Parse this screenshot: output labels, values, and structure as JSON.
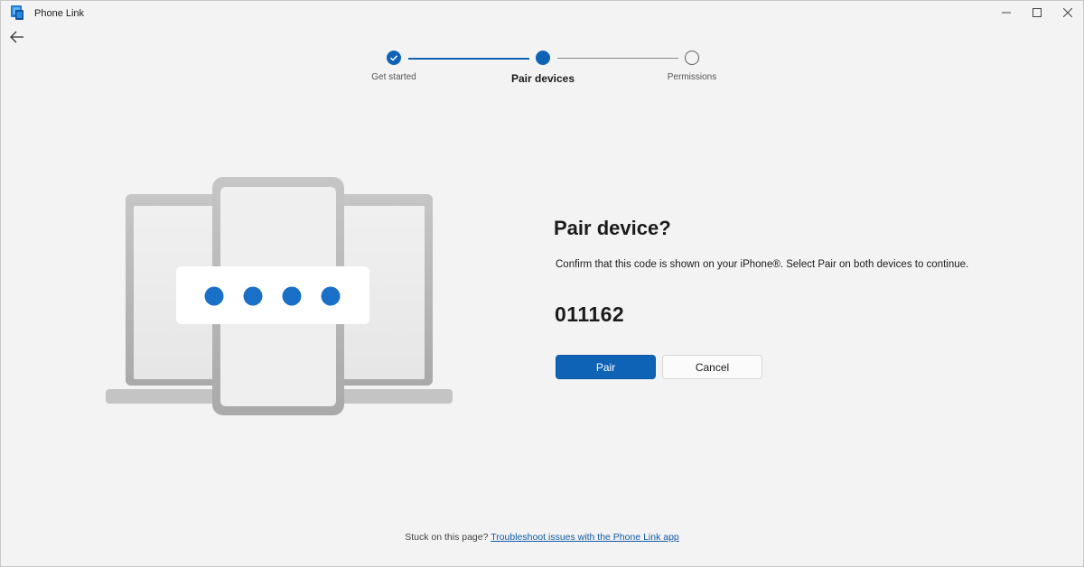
{
  "window": {
    "title": "Phone Link",
    "controls": {
      "minimize": "—",
      "maximize": "☐",
      "close": "✕"
    }
  },
  "stepper": {
    "steps": [
      {
        "label": "Get started",
        "state": "done"
      },
      {
        "label": "Pair devices",
        "state": "current"
      },
      {
        "label": "Permissions",
        "state": "todo"
      }
    ]
  },
  "panel": {
    "title": "Pair device?",
    "description": "Confirm that this code is shown on your iPhone®. Select Pair on both devices to continue.",
    "code": "011162",
    "pair_label": "Pair",
    "cancel_label": "Cancel"
  },
  "footer": {
    "text": "Stuck on this page?",
    "link": "Troubleshoot issues with the Phone Link app"
  },
  "colors": {
    "accent": "#0f63b6",
    "background": "#f3f3f3"
  }
}
